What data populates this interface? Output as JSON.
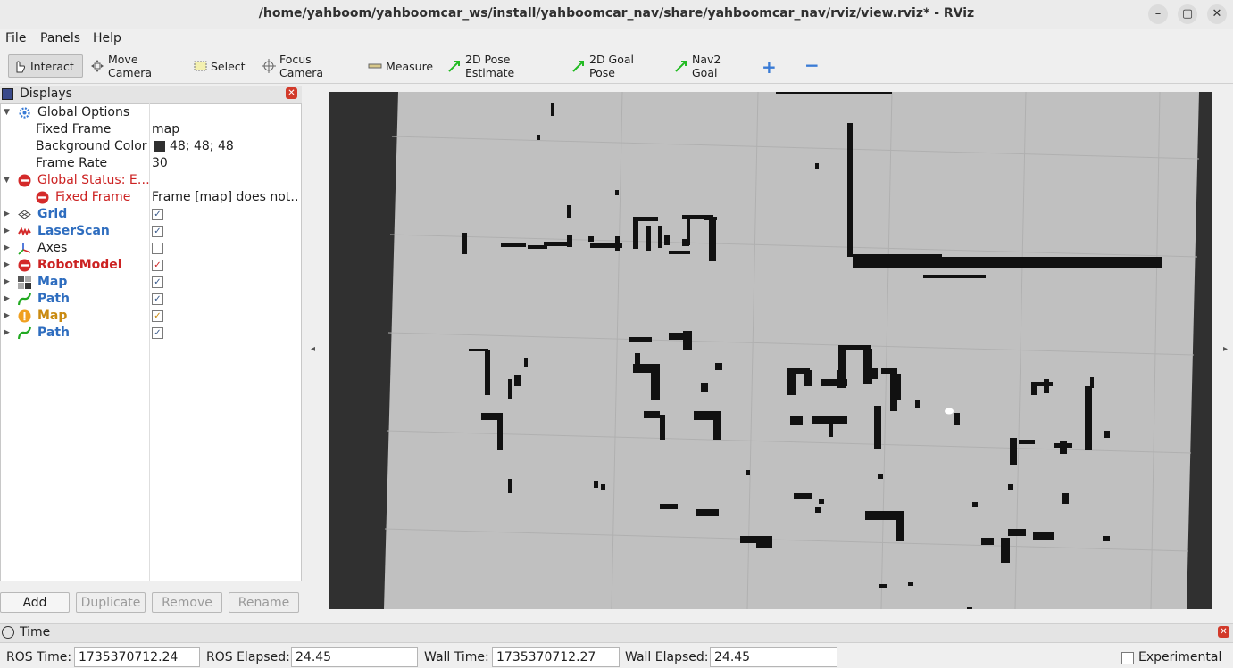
{
  "window": {
    "title": "/home/yahboom/yahboomcar_ws/install/yahboomcar_nav/share/yahboomcar_nav/rviz/view.rviz* - RViz",
    "minimize": "–",
    "maximize": "▢",
    "close": "✕"
  },
  "menubar": {
    "items": [
      {
        "label": "File"
      },
      {
        "label": "Panels"
      },
      {
        "label": "Help"
      }
    ]
  },
  "toolbar": {
    "tools": [
      {
        "label": "Interact",
        "icon": "hand-cursor-icon",
        "active": true
      },
      {
        "label": "Move Camera",
        "icon": "move-camera-icon"
      },
      {
        "label": "Select",
        "icon": "select-box-icon"
      },
      {
        "label": "Focus Camera",
        "icon": "focus-camera-icon"
      },
      {
        "label": "Measure",
        "icon": "ruler-icon"
      },
      {
        "label": "2D Pose Estimate",
        "icon": "green-arrow-icon"
      },
      {
        "label": "2D Goal Pose",
        "icon": "green-arrow-icon"
      },
      {
        "label": "Nav2 Goal",
        "icon": "green-arrow-icon"
      }
    ],
    "add_tool": "+",
    "remove_tool": "−"
  },
  "displays_panel": {
    "title": "Displays",
    "rows": [
      {
        "label": "Global Options",
        "icon": "gear-icon",
        "expanded": true
      },
      {
        "label": "Fixed Frame",
        "value": "map"
      },
      {
        "label": "Background Color",
        "value": "48; 48; 48",
        "swatch": "#303030"
      },
      {
        "label": "Frame Rate",
        "value": "30"
      },
      {
        "label": "Global Status: E…",
        "icon": "error-icon",
        "expanded": true
      },
      {
        "label": "Fixed Frame",
        "value": "Frame [map] does not…",
        "icon": "error-icon"
      },
      {
        "label": "Grid",
        "icon": "grid-icon",
        "checked": true
      },
      {
        "label": "LaserScan",
        "icon": "laserscan-icon",
        "checked": true
      },
      {
        "label": "Axes",
        "icon": "axes-icon",
        "checked": false
      },
      {
        "label": "RobotModel",
        "icon": "error-icon",
        "checked": true
      },
      {
        "label": "Map",
        "icon": "map-icon",
        "checked": true
      },
      {
        "label": "Path",
        "icon": "path-icon",
        "checked": true
      },
      {
        "label": "Map",
        "icon": "warning-icon",
        "checked": true
      },
      {
        "label": "Path",
        "icon": "path-icon",
        "checked": true
      }
    ],
    "buttons": [
      {
        "label": "Add",
        "enabled": true
      },
      {
        "label": "Duplicate",
        "enabled": false
      },
      {
        "label": "Remove",
        "enabled": false
      },
      {
        "label": "Rename",
        "enabled": false
      }
    ],
    "check_mark": "✓"
  },
  "viewport": {
    "background_color": "#303030",
    "map_free_color": "#c0c0c0",
    "obstacle_color": "#111111",
    "left_arrow": "◂",
    "right_arrow": "▸"
  },
  "time_panel": {
    "title": "Time",
    "ros_time_label": "ROS Time:",
    "ros_time": "1735370712.24",
    "ros_elapsed_label": "ROS Elapsed:",
    "ros_elapsed": "24.45",
    "wall_time_label": "Wall Time:",
    "wall_time": "1735370712.27",
    "wall_elapsed_label": "Wall Elapsed:",
    "wall_elapsed": "24.45",
    "experimental_label": "Experimental",
    "experimental_checked": false
  }
}
